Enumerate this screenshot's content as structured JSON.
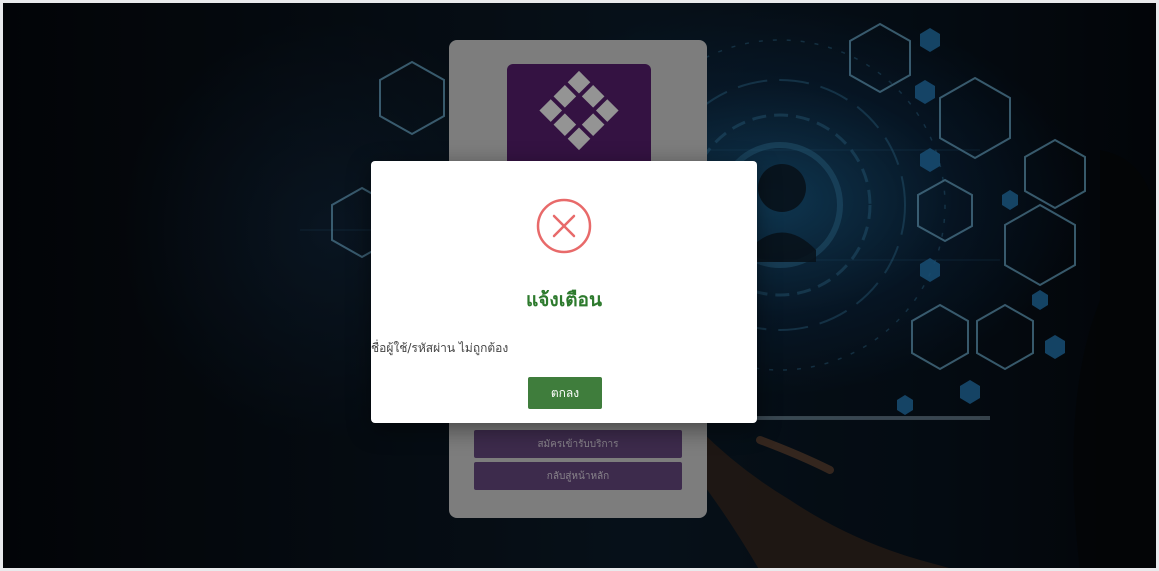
{
  "login": {
    "register_label": "สมัครเข้ารับบริการ",
    "home_label": "กลับสู่หน้าหลัก"
  },
  "dialog": {
    "icon": "x-circle-icon",
    "title": "แจ้งเตือน",
    "message": "ชื่อผู้ใช้/รหัสผ่าน ไม่ถูกต้อง",
    "ok_label": "ตกลง"
  },
  "colors": {
    "title_green": "#2d7a2d",
    "ok_button_green": "#3f7d3c",
    "error_red": "#e86a6a",
    "logo_purple": "#5a1f73",
    "login_button_purple": "#6a4a84"
  }
}
